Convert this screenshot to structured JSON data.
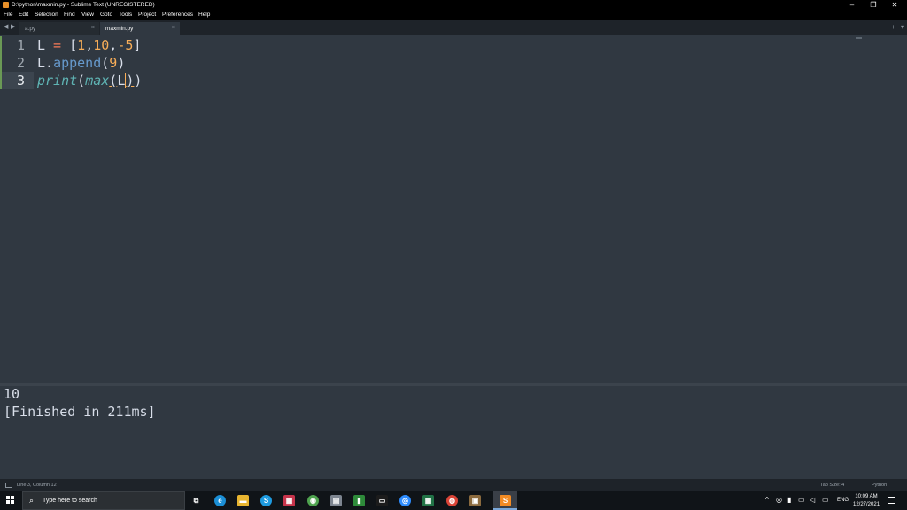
{
  "window": {
    "title": "D:\\python\\maxmin.py - Sublime Text (UNREGISTERED)",
    "controls": {
      "minimize": "–",
      "restore": "❐",
      "close": "✕"
    }
  },
  "menu": [
    "File",
    "Edit",
    "Selection",
    "Find",
    "View",
    "Goto",
    "Tools",
    "Project",
    "Preferences",
    "Help"
  ],
  "tabs": {
    "nav_left": "◀",
    "nav_right": "▶",
    "items": [
      {
        "label": "a.py",
        "close": "×",
        "active": false
      },
      {
        "label": "maxmin.py",
        "close": "×",
        "active": true
      }
    ],
    "plus": "+",
    "dropdown": "▾"
  },
  "editor": {
    "line_numbers": [
      "1",
      "2",
      "3"
    ],
    "lines": [
      {
        "var": "L",
        "eq": " = ",
        "open": "[",
        "n1": "1",
        "c1": ",",
        "n2": "10",
        "c2": ",",
        "n3": "-5",
        "close": "]"
      },
      {
        "var": "L",
        "dot": ".",
        "method": "append",
        "open": "(",
        "n1": "9",
        "close": ")"
      },
      {
        "func1": "print",
        "open1": "(",
        "func2": "max",
        "open2": "(",
        "arg": "L",
        "close2": ")",
        "close1": ")"
      }
    ],
    "active_line": 3
  },
  "console": {
    "output": [
      "10",
      "[Finished in 211ms]"
    ]
  },
  "status": {
    "cursor": "Line 3, Column 12",
    "tab_size": "Tab Size: 4",
    "syntax": "Python"
  },
  "taskbar": {
    "search_placeholder": "Type here to search",
    "apps": [
      {
        "name": "task-view",
        "color": "#101418",
        "glyph": "⧉"
      },
      {
        "name": "edge",
        "color": "#1b8fd6",
        "glyph": "e"
      },
      {
        "name": "file-explorer",
        "color": "#e8b530",
        "glyph": "▬"
      },
      {
        "name": "skype",
        "color": "#1e9be0",
        "glyph": "S"
      },
      {
        "name": "app-red",
        "color": "#c7344b",
        "glyph": "▦"
      },
      {
        "name": "app-green",
        "color": "#4fa34f",
        "glyph": "◉"
      },
      {
        "name": "app-gray",
        "color": "#7d8590",
        "glyph": "▤"
      },
      {
        "name": "app-green-doc",
        "color": "#2e8b3a",
        "glyph": "▮"
      },
      {
        "name": "terminal",
        "color": "#1c1c1c",
        "glyph": "▭"
      },
      {
        "name": "zoom",
        "color": "#2d8cff",
        "glyph": "◎"
      },
      {
        "name": "app-excel",
        "color": "#217346",
        "glyph": "▦"
      },
      {
        "name": "chrome",
        "color": "#db4437",
        "glyph": "◍"
      },
      {
        "name": "app-box",
        "color": "#8b6a3e",
        "glyph": "▣"
      },
      {
        "name": "sublime-text",
        "color": "#f28b24",
        "glyph": "S"
      }
    ],
    "tray": {
      "chevron": "^",
      "language": "ENG",
      "time": "10:09 AM",
      "date": "12/27/2021"
    }
  }
}
